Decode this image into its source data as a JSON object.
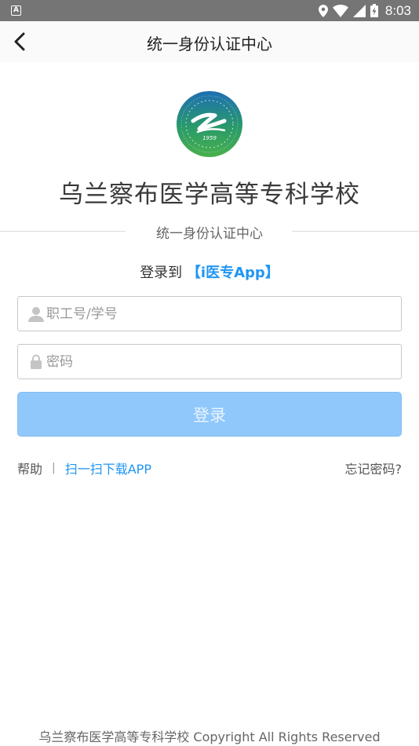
{
  "status_bar": {
    "notification_letter": "A",
    "time": "8:03",
    "icons": [
      "location-icon",
      "wifi-icon",
      "signal-icon",
      "battery-icon"
    ]
  },
  "app_bar": {
    "title": "统一身份认证中心",
    "back_icon": "chevron-left-icon"
  },
  "school": {
    "name": "乌兰察布医学高等专科学校",
    "logo_year": "1959",
    "logo_colors": {
      "outer": "#1e8a6e",
      "inner": "#2f9e5a",
      "gradient_top": "#1d6fb3",
      "gradient_bottom": "#48b04c"
    }
  },
  "divider": {
    "label": "统一身份认证中心"
  },
  "login_to": {
    "prefix": "登录到",
    "app_name": "【i医专App】"
  },
  "form": {
    "username_placeholder": "职工号/学号",
    "username_value": "",
    "password_placeholder": "密码",
    "password_value": "",
    "submit_label": "登录"
  },
  "links": {
    "help": "帮助",
    "separator": "|",
    "scan_download": "扫一扫下载APP",
    "forgot_password": "忘记密码?"
  },
  "footer": {
    "text": "乌兰察布医学高等专科学校 Copyright All Rights Reserved"
  },
  "colors": {
    "accent": "#2196f3",
    "button_bg": "#90c8fb",
    "status_bar": "#757575"
  }
}
